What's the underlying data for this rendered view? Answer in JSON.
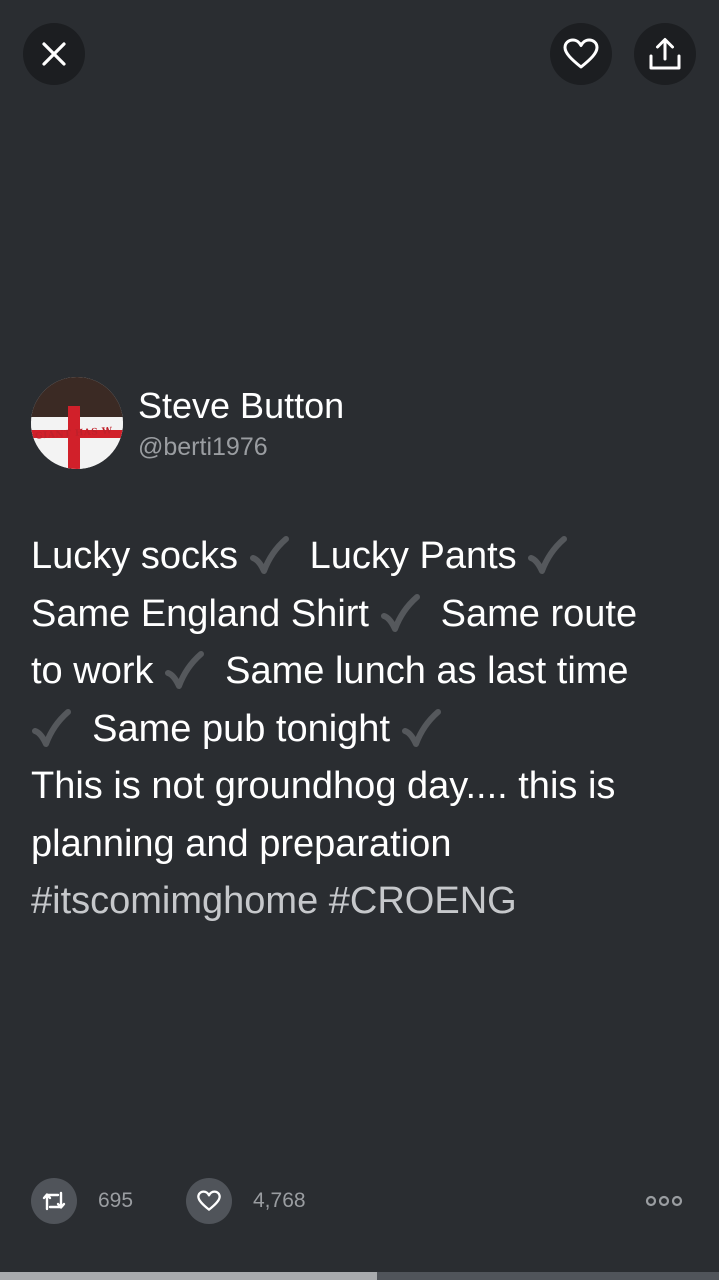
{
  "top_bar": {
    "close_icon": "close-icon",
    "like_icon": "heart-icon",
    "share_icon": "share-icon"
  },
  "author": {
    "display_name": "Steve Button",
    "handle": "@berti1976",
    "avatar_banner_text": "GIANT HAS W"
  },
  "tweet": {
    "lines": [
      [
        "Lucky socks",
        "check",
        "Lucky Pants",
        "check"
      ],
      [
        "Same England Shirt",
        "check",
        "Same route"
      ],
      [
        "to work",
        "check",
        "Same lunch as last time"
      ],
      [
        "check",
        "Same pub tonight",
        "check"
      ]
    ],
    "line5": "This is not groundhog day.... this is",
    "line6": "planning and preparation",
    "hashtags": "#itscomimghome #CROENG"
  },
  "actions": {
    "retweet_count": "695",
    "like_count": "4,768",
    "more_icon": "more-icon"
  },
  "progress": {
    "fraction": 0.525
  },
  "colors": {
    "background": "#2a2d31",
    "button_bg": "#1c1e21",
    "action_bg": "#50545a",
    "muted_text": "#9a9da1",
    "check_gray": "#55585c"
  }
}
